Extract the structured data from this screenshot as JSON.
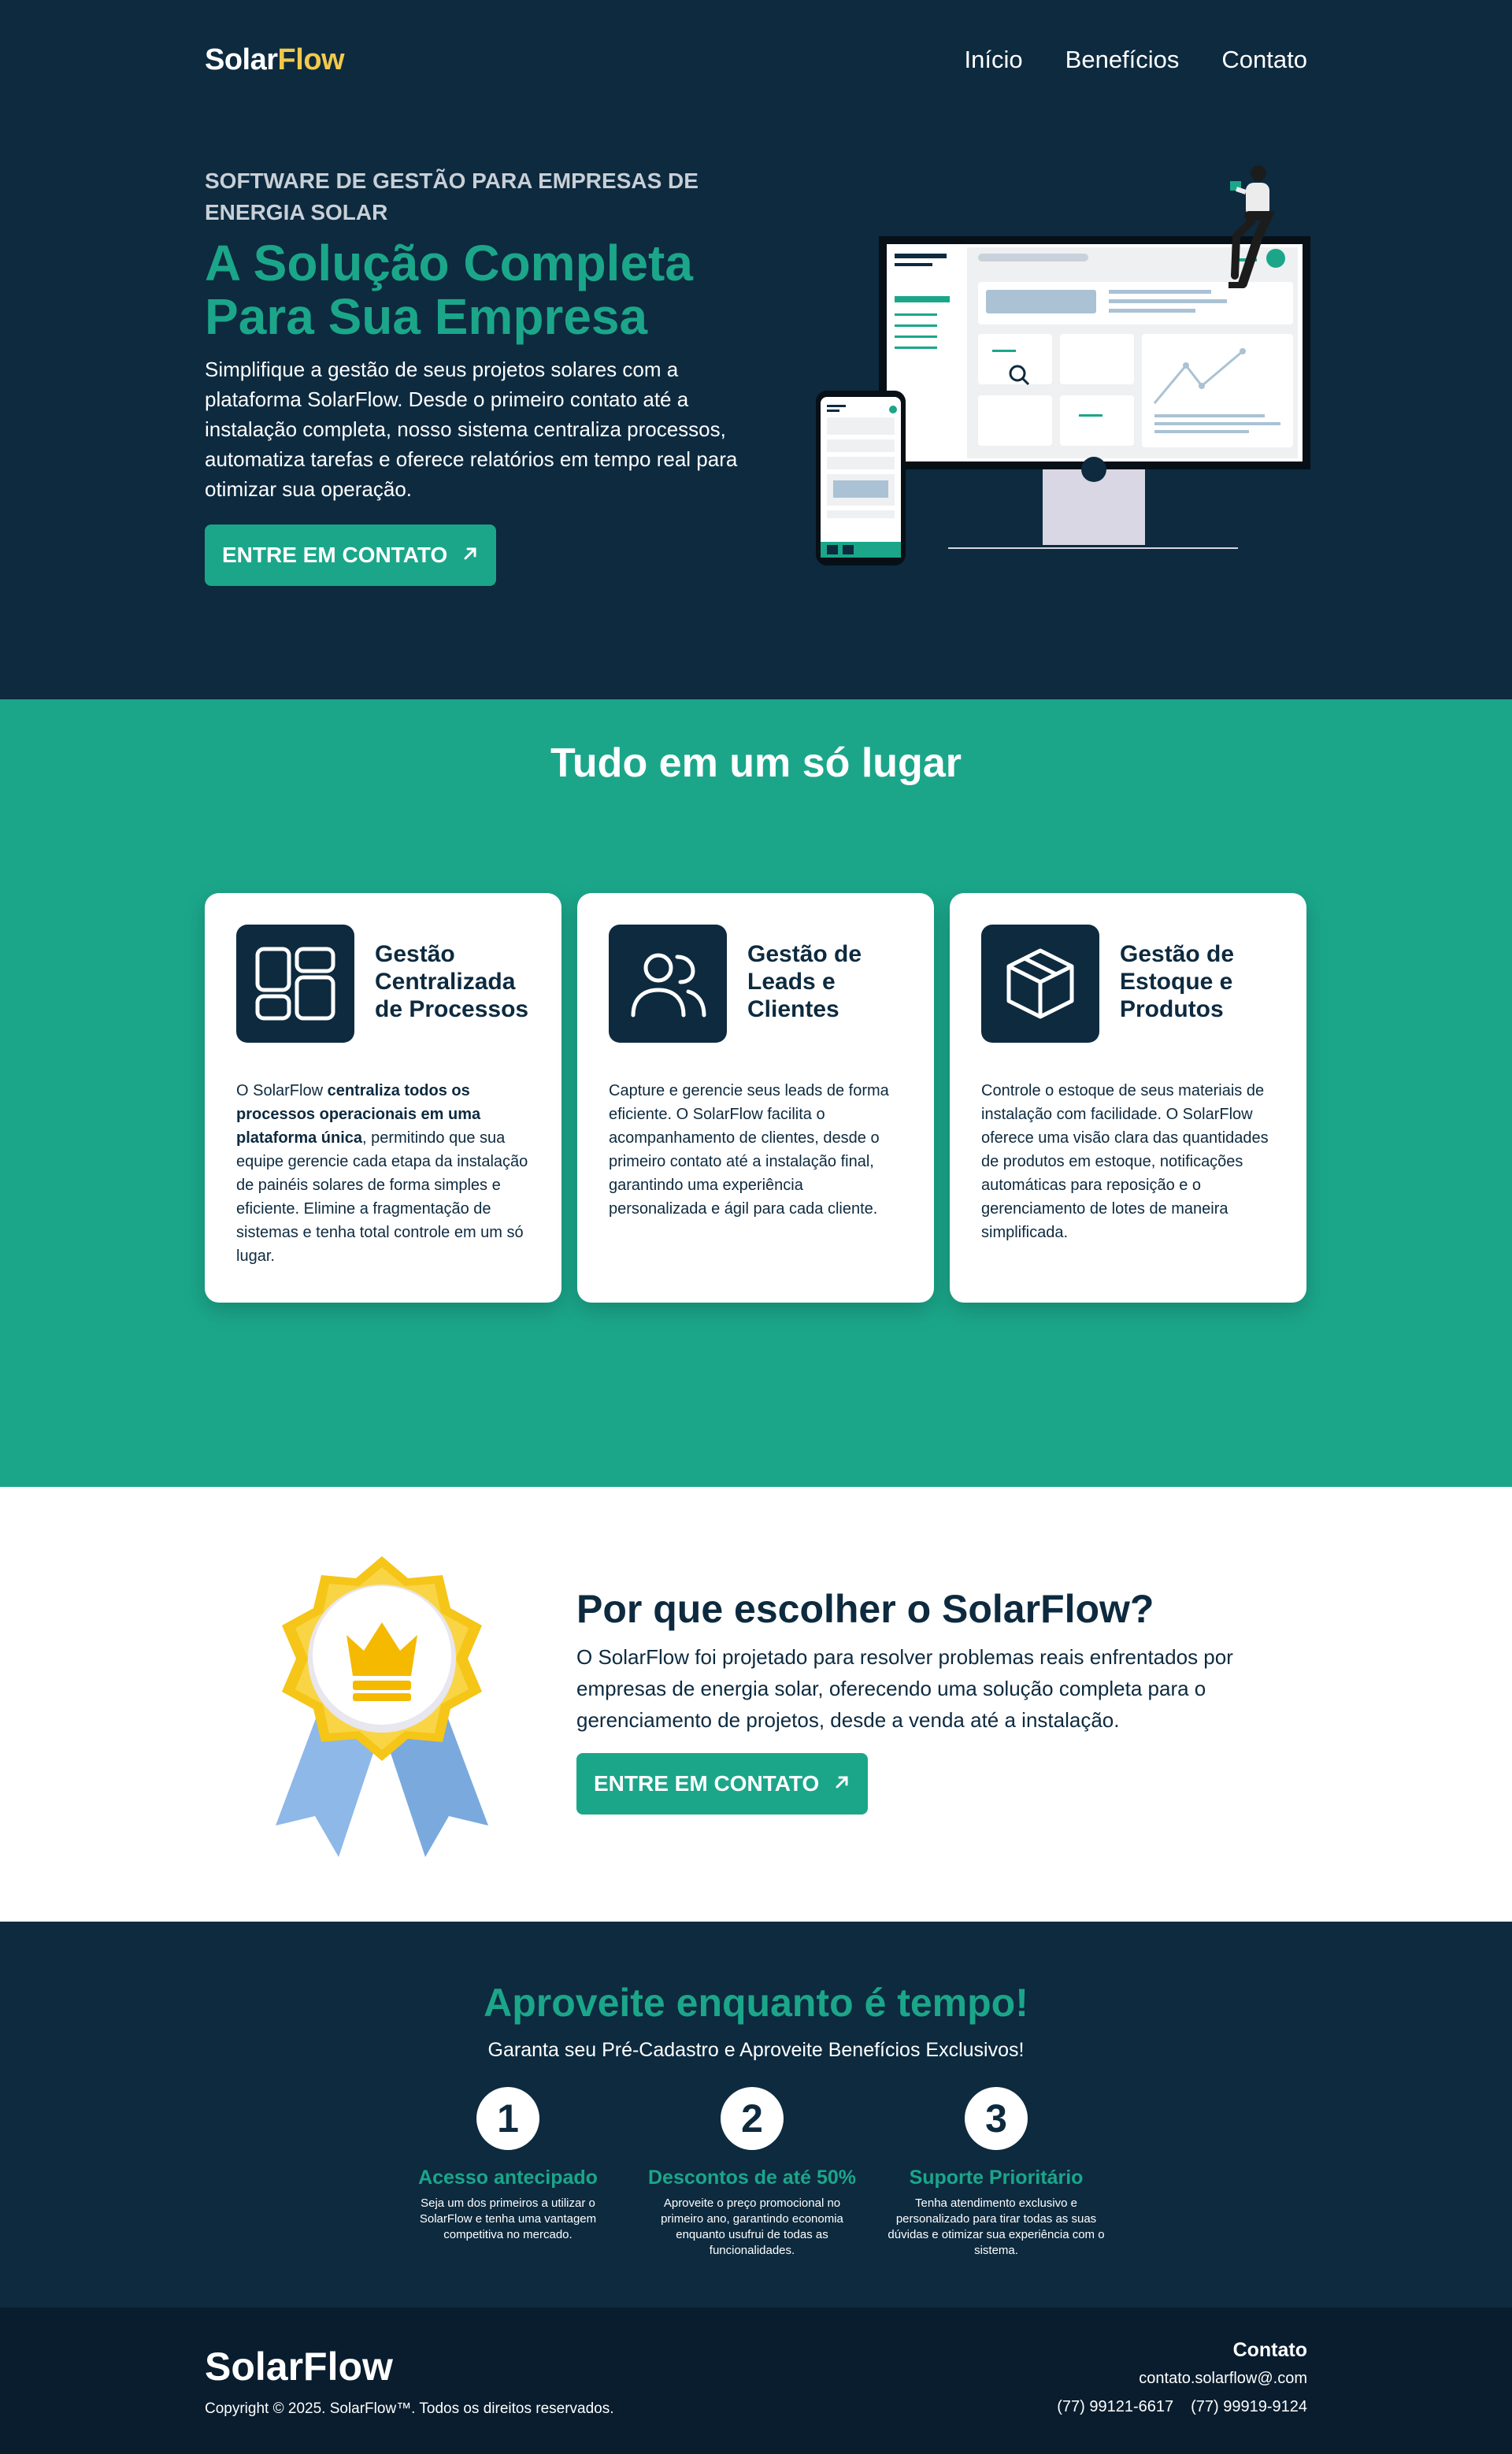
{
  "nav": {
    "logo_solar": "Solar",
    "logo_flow": "Flow",
    "links": [
      "Início",
      "Benefícios",
      "Contato"
    ]
  },
  "hero": {
    "eyebrow": "SOFTWARE DE GESTÃO PARA EMPRESAS DE ENERGIA SOLAR",
    "title": "A Solução Completa Para Sua Empresa",
    "description": "Simplifique a gestão de seus projetos solares com a plataforma SolarFlow. Desde o primeiro contato até a instalação completa, nosso sistema centraliza processos, automatiza tarefas e oferece relatórios em tempo real para otimizar sua operação.",
    "cta": "ENTRE EM CONTATO",
    "cta_icon": "arrow-up-right-icon"
  },
  "features": {
    "title_bold": "Tudo",
    "title_rest": " em um só lugar",
    "cards": [
      {
        "icon": "dashboard-icon",
        "title": "Gestão Centralizada de Processos",
        "text_parts": [
          {
            "t": "O SolarFlow ",
            "b": false
          },
          {
            "t": "centraliza todos os processos operacionais em uma plataforma única",
            "b": true
          },
          {
            "t": ", permitindo que sua equipe gerencie cada etapa da instalação de painéis solares de forma simples e eficiente. Elimine a fragmentação de sistemas e tenha total controle em um só lugar.",
            "b": false
          }
        ]
      },
      {
        "icon": "users-icon",
        "title": "Gestão de Leads e Clientes",
        "text": "Capture e gerencie seus leads de forma eficiente. O SolarFlow facilita o acompanhamento de clientes, desde o primeiro contato até a instalação final, garantindo uma experiência personalizada e ágil para cada cliente."
      },
      {
        "icon": "box-icon",
        "title": "Gestão de Estoque e Produtos",
        "text": "Controle o estoque de seus materiais de instalação com facilidade. O SolarFlow oferece uma visão clara das quantidades de produtos em estoque, notificações automáticas para reposição e o gerenciamento de lotes de maneira simplificada."
      }
    ]
  },
  "why": {
    "title": "Por que escolher o SolarFlow?",
    "description": "O SolarFlow foi projetado para resolver problemas reais enfrentados por empresas de energia solar, oferecendo uma solução completa para o gerenciamento de projetos, desde a venda até a instalação.",
    "cta": "ENTRE EM CONTATO"
  },
  "promo": {
    "title": "Aproveite enquanto é tempo!",
    "subtitle": "Garanta seu Pré-Cadastro e Aproveite Benefícios Exclusivos!",
    "steps": [
      {
        "num": "1",
        "title": "Acesso antecipado",
        "text": "Seja um dos primeiros a utilizar o SolarFlow e tenha uma vantagem competitiva no mercado."
      },
      {
        "num": "2",
        "title": "Descontos de até 50%",
        "text": "Aproveite o preço promocional no primeiro ano, garantindo economia enquanto usufrui de todas as funcionalidades."
      },
      {
        "num": "3",
        "title": "Suporte Prioritário",
        "text": "Tenha atendimento exclusivo e personalizado para tirar todas as suas dúvidas e otimizar sua experiência com o sistema."
      }
    ]
  },
  "footer": {
    "logo": "SolarFlow",
    "copyright": "Copyright © 2025. SolarFlow™. Todos os direitos reservados.",
    "contact_title": "Contato",
    "email": "contato.solarflow@.com",
    "phone_1": "(77) 99121-6617",
    "phone_2": "(77) 99919-9124"
  },
  "colors": {
    "navy": "#0d2a3f",
    "teal": "#1ba68a",
    "yellow": "#f2c94c",
    "footer": "#091d2e"
  }
}
